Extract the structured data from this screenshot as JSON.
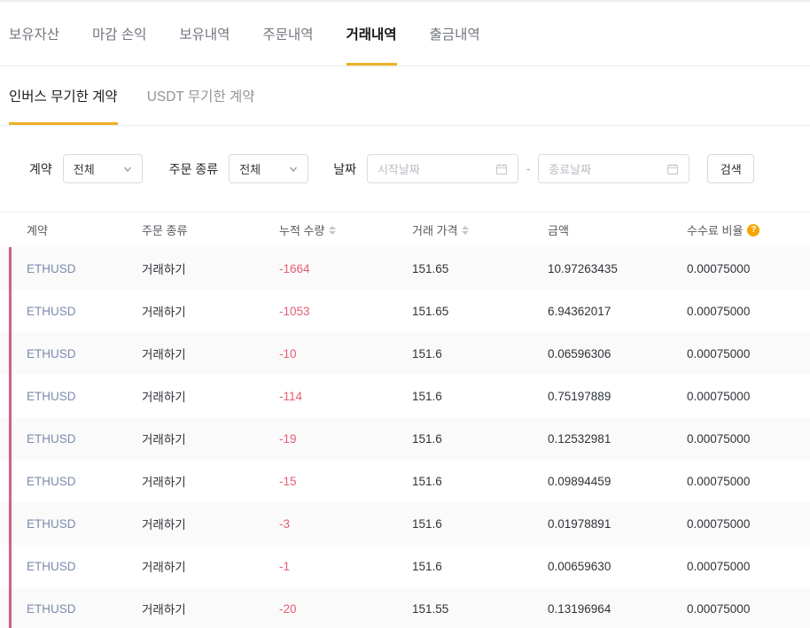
{
  "tabs": [
    {
      "label": "보유자산",
      "active": false
    },
    {
      "label": "마감 손익",
      "active": false
    },
    {
      "label": "보유내역",
      "active": false
    },
    {
      "label": "주문내역",
      "active": false
    },
    {
      "label": "거래내역",
      "active": true
    },
    {
      "label": "출금내역",
      "active": false
    }
  ],
  "subtabs": [
    {
      "label": "인버스 무기한 계약",
      "active": true
    },
    {
      "label": "USDT 무기한 계약",
      "active": false
    }
  ],
  "filters": {
    "contract_label": "계약",
    "contract_value": "전체",
    "order_type_label": "주문 종류",
    "order_type_value": "전체",
    "date_label": "날짜",
    "start_date_placeholder": "시작날짜",
    "end_date_placeholder": "종료날짜",
    "range_separator": "-",
    "search_button": "검색"
  },
  "table": {
    "columns": [
      {
        "label": "계약",
        "sortable": false
      },
      {
        "label": "주문 종류",
        "sortable": false
      },
      {
        "label": "누적 수량",
        "sortable": true
      },
      {
        "label": "거래 가격",
        "sortable": true
      },
      {
        "label": "금액",
        "sortable": false
      },
      {
        "label": "수수료 비율",
        "sortable": false,
        "help": true
      }
    ],
    "rows": [
      [
        "ETHUSD",
        "거래하기",
        "-1664",
        "151.65",
        "10.97263435",
        "0.00075000"
      ],
      [
        "ETHUSD",
        "거래하기",
        "-1053",
        "151.65",
        "6.94362017",
        "0.00075000"
      ],
      [
        "ETHUSD",
        "거래하기",
        "-10",
        "151.6",
        "0.06596306",
        "0.00075000"
      ],
      [
        "ETHUSD",
        "거래하기",
        "-114",
        "151.6",
        "0.75197889",
        "0.00075000"
      ],
      [
        "ETHUSD",
        "거래하기",
        "-19",
        "151.6",
        "0.12532981",
        "0.00075000"
      ],
      [
        "ETHUSD",
        "거래하기",
        "-15",
        "151.6",
        "0.09894459",
        "0.00075000"
      ],
      [
        "ETHUSD",
        "거래하기",
        "-3",
        "151.6",
        "0.01978891",
        "0.00075000"
      ],
      [
        "ETHUSD",
        "거래하기",
        "-1",
        "151.6",
        "0.00659630",
        "0.00075000"
      ],
      [
        "ETHUSD",
        "거래하기",
        "-20",
        "151.55",
        "0.13196964",
        "0.00075000"
      ]
    ]
  },
  "colors": {
    "accent_gold": "#eeb024",
    "help_icon_orange": "#f7a600",
    "negative_red": "#e85c75",
    "edge_stripe_pink": "#cd6286",
    "contract_link_blue": "#7d8aad"
  }
}
